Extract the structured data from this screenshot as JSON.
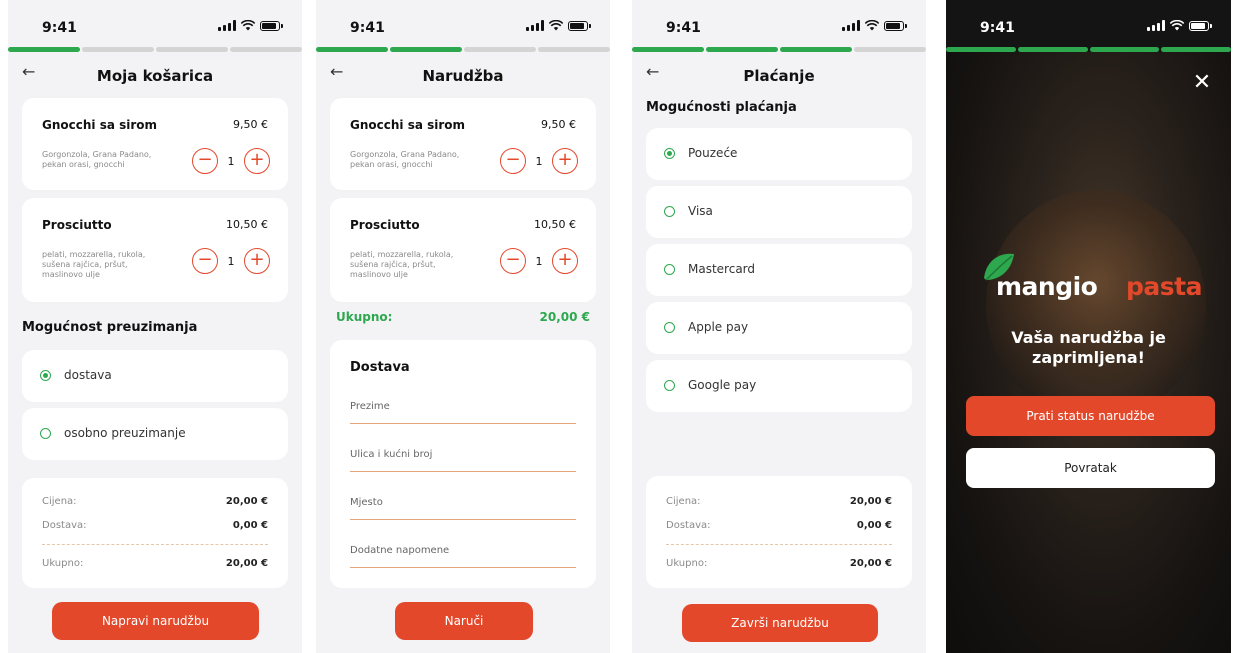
{
  "status": {
    "time": "9:41"
  },
  "colors": {
    "accent": "#e4482b",
    "green": "#2ea84f"
  },
  "cart": {
    "title": "Moja košarica",
    "items": [
      {
        "name": "Gnocchi sa sirom",
        "price": "9,50 €",
        "desc": "Gorgonzola, Grana Padano, pekan orasi, gnocchi",
        "qty": "1"
      },
      {
        "name": "Prosciutto",
        "price": "10,50 €",
        "desc": "pelati, mozzarella, rukola, sušena rajčica, pršut, maslinovo ulje",
        "qty": "1"
      }
    ],
    "pickup_title": "Mogućnost preuzimanja",
    "pickup_options": [
      "dostava",
      "osobno preuzimanje"
    ],
    "summary": {
      "price_label": "Cijena:",
      "price": "20,00 €",
      "delivery_label": "Dostava:",
      "delivery": "0,00 €",
      "total_label": "Ukupno:",
      "total": "20,00 €"
    },
    "cta": "Napravi narudžbu"
  },
  "order": {
    "title": "Narudžba",
    "total_label": "Ukupno:",
    "total": "20,00 €",
    "form_title": "Dostava",
    "fields": [
      "Prezime",
      "Ulica i kućni broj",
      "Mjesto",
      "Dodatne napomene"
    ],
    "cta": "Naruči"
  },
  "payment": {
    "title": "Plaćanje",
    "section_title": "Mogućnosti plaćanja",
    "options": [
      "Pouzeće",
      "Visa",
      "Mastercard",
      "Apple pay",
      "Google pay"
    ],
    "cta": "Završi narudžbu"
  },
  "confirm": {
    "logo_word1": "mangio",
    "logo_word2": "pasta",
    "message_line1": "Vaša narudžba je",
    "message_line2": "zaprimljena!",
    "track_button": "Prati status narudžbe",
    "back_button": "Povratak"
  }
}
